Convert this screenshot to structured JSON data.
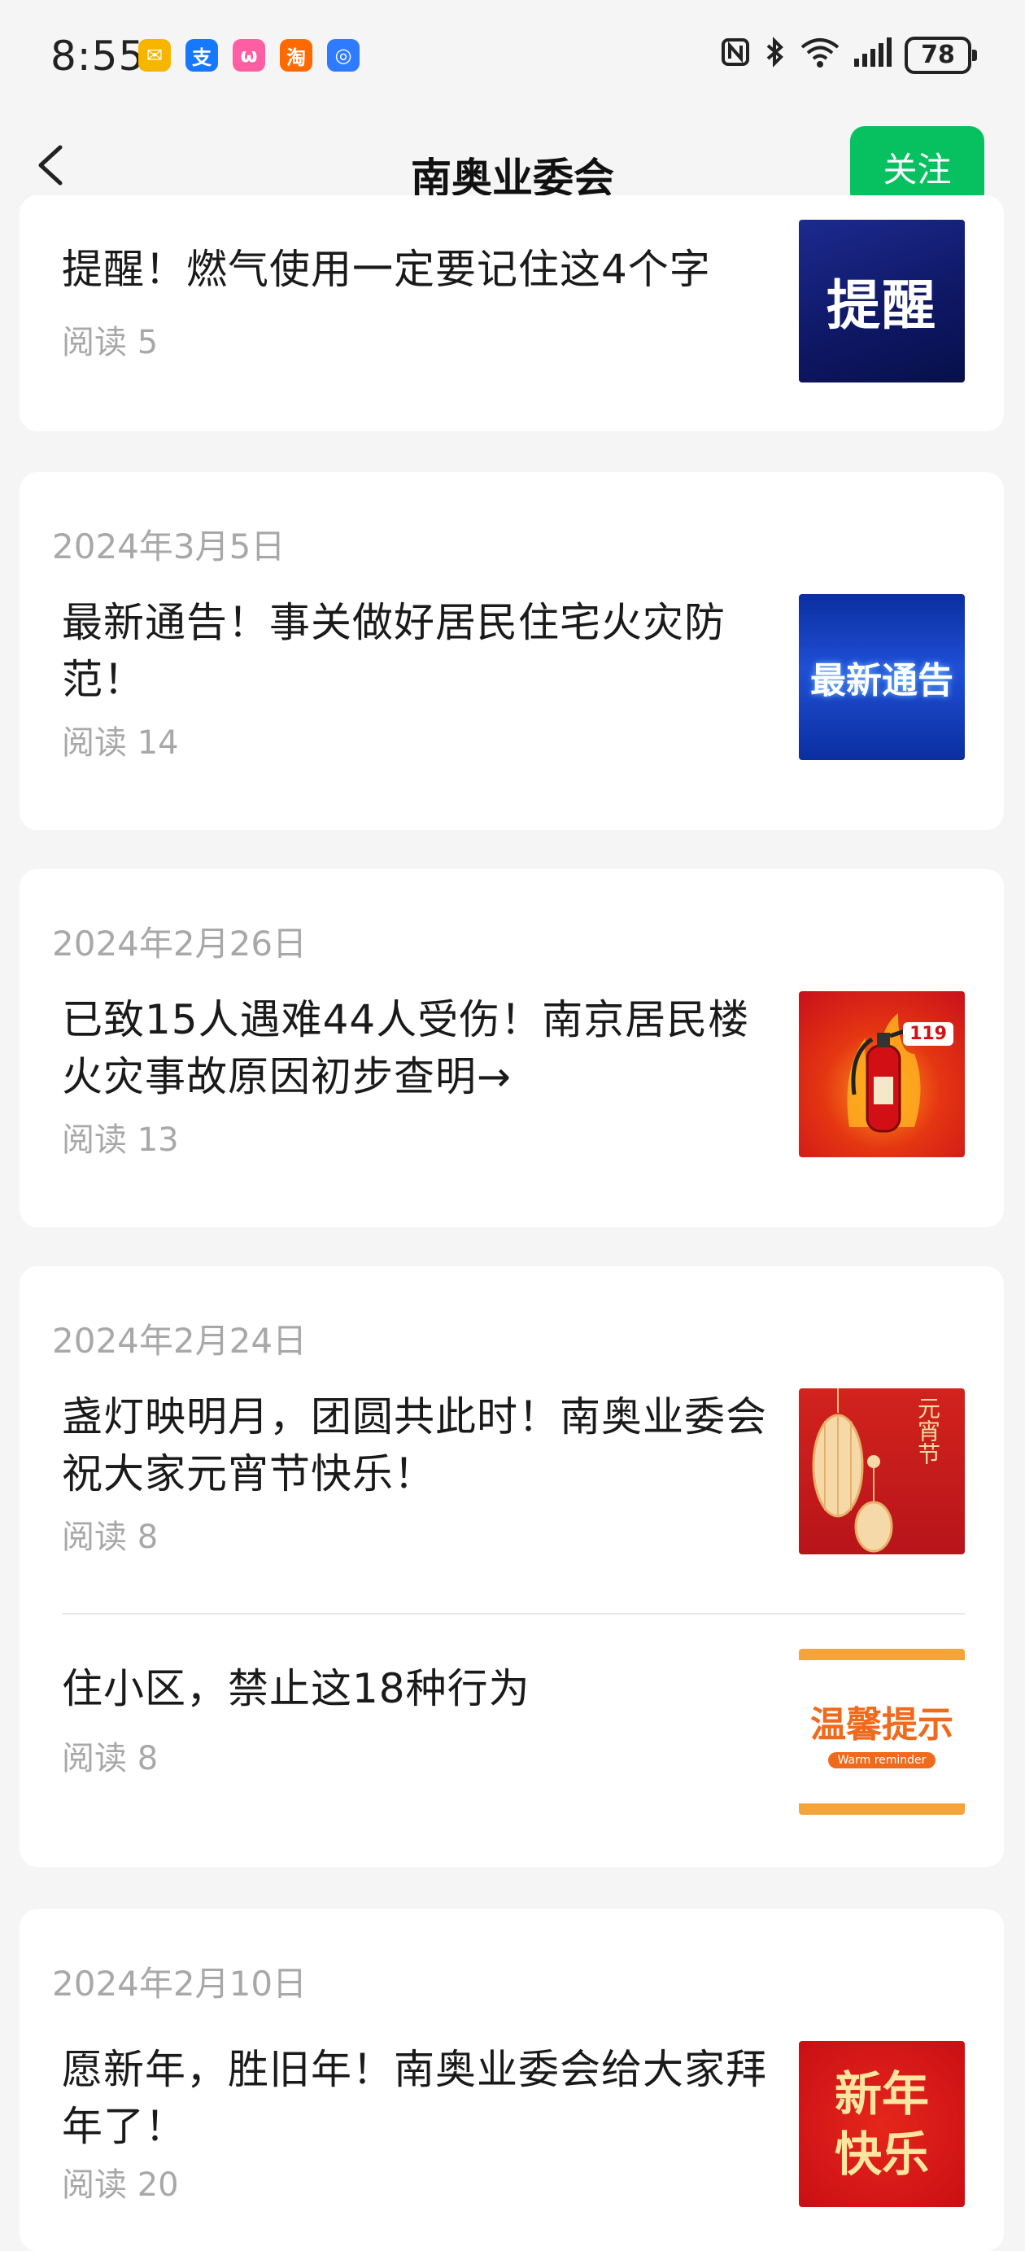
{
  "status_bar": {
    "time": "8:55",
    "app_icons": [
      "mail-app-icon",
      "alipay-icon",
      "ai-app-icon",
      "taobao-icon",
      "browser-icon"
    ],
    "app_glyphs": [
      "✉",
      "支",
      "ω",
      "淘",
      "◎"
    ],
    "app_colors": [
      "#f7b500",
      "#1677ff",
      "#ff5fa2",
      "#ff6a00",
      "#2f7bff"
    ],
    "battery": "78"
  },
  "nav": {
    "title": "南奥业委会",
    "follow_label": "关注"
  },
  "groups": [
    {
      "date": "",
      "articles": [
        {
          "title": "提醒！燃气使用一定要记住这4个字",
          "reads": "阅读 5",
          "thumb_text": "提醒"
        }
      ]
    },
    {
      "date": "2024年3月5日",
      "articles": [
        {
          "title": "最新通告！事关做好居民住宅火灾防范！",
          "reads": "阅读 14",
          "thumb_text": "最新通告"
        }
      ]
    },
    {
      "date": "2024年2月26日",
      "articles": [
        {
          "title": "已致15人遇难44人受伤！南京居民楼火灾事故原因初步查明→",
          "reads": "阅读 13",
          "thumb_text": "119"
        }
      ]
    },
    {
      "date": "2024年2月24日",
      "articles": [
        {
          "title": "盏灯映明月，团圆共此时！南奥业委会祝大家元宵节快乐！",
          "reads": "阅读 8",
          "thumb_text": "元宵节"
        },
        {
          "title": "住小区，禁止这18种行为",
          "reads": "阅读 8",
          "thumb_text": "温馨提示",
          "thumb_subtext": "Warm reminder"
        }
      ]
    },
    {
      "date": "2024年2月10日",
      "articles": [
        {
          "title": "愿新年，胜旧年！南奥业委会给大家拜年了！",
          "reads": "阅读 20",
          "thumb_text": "新年快乐"
        }
      ]
    }
  ],
  "colors": {
    "accent": "#07c160",
    "background": "#f5f5f5",
    "card": "#ffffff",
    "muted_text": "#a8a8a8"
  }
}
